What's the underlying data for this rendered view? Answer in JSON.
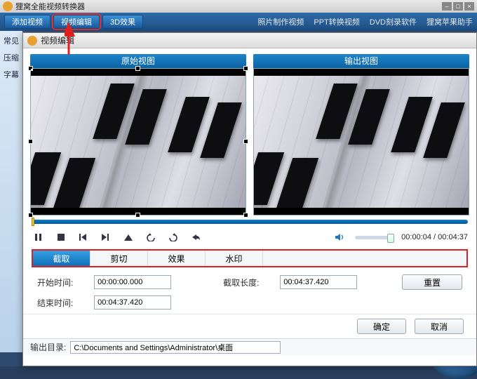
{
  "app": {
    "title": "狸窝全能视频转换器"
  },
  "mainToolbar": {
    "addVideo": "添加视频",
    "videoEdit": "视频编辑",
    "effect3d": "3D效果"
  },
  "topLinks": {
    "photo": "照片制作视频",
    "ppt": "PPT转换视频",
    "dvd": "DVD刻录软件",
    "apple": "狸窝苹果助手"
  },
  "sidebar": {
    "item1": "常见",
    "item2": "压缩",
    "item3": "字幕"
  },
  "editor": {
    "title": "视频编辑",
    "originalView": "原始视图",
    "outputView": "输出视图",
    "time": {
      "current": "00:00:04",
      "total": "00:04:37"
    },
    "tabs": {
      "crop": "截取",
      "clip": "剪切",
      "effect": "效果",
      "watermark": "水印"
    },
    "params": {
      "startLabel": "开始时间:",
      "startValue": "00:00:00.000",
      "endLabel": "结束时间:",
      "endValue": "00:04:37.420",
      "durationLabel": "截取长度:",
      "durationValue": "00:04:37.420",
      "reset": "重置"
    },
    "ok": "确定",
    "cancel": "取消",
    "outputLabel": "输出目录:",
    "outputPath": "C:\\Documents and Settings\\Administrator\\桌面"
  }
}
